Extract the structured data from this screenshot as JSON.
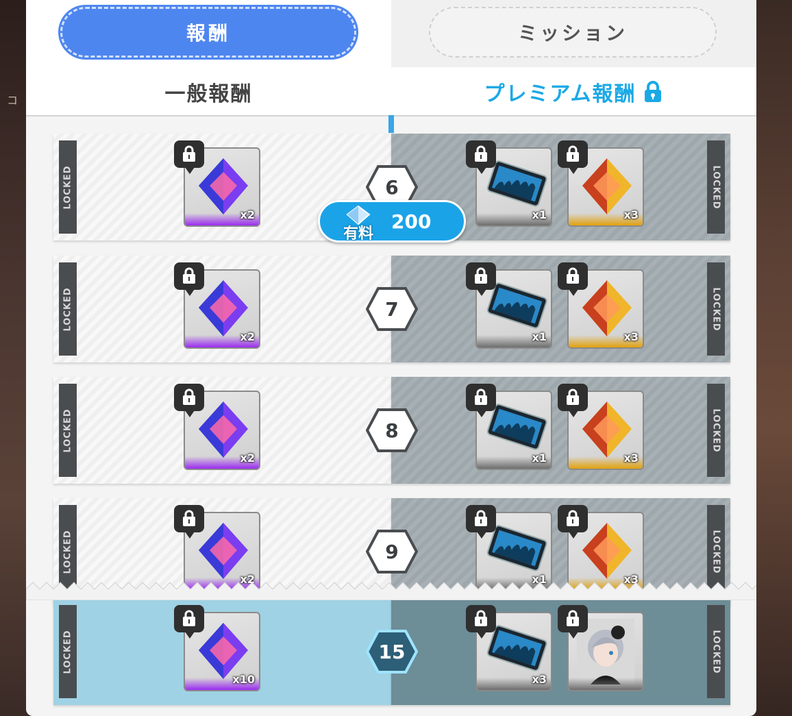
{
  "tabs": {
    "reward": "報酬",
    "mission": "ミッション"
  },
  "columns": {
    "general": "一般報酬",
    "premium": "プレミアム報酬"
  },
  "locked_label": "LOCKED",
  "paid_badge": {
    "label": "有料",
    "amount": "200"
  },
  "rows": [
    {
      "level": "6",
      "general": {
        "qty": "x2"
      },
      "premium": [
        {
          "qty": "x1"
        },
        {
          "qty": "x3"
        }
      ]
    },
    {
      "level": "7",
      "general": {
        "qty": "x2"
      },
      "premium": [
        {
          "qty": "x1"
        },
        {
          "qty": "x3"
        }
      ]
    },
    {
      "level": "8",
      "general": {
        "qty": "x2"
      },
      "premium": [
        {
          "qty": "x1"
        },
        {
          "qty": "x3"
        }
      ]
    },
    {
      "level": "9",
      "general": {
        "qty": "x2"
      },
      "premium": [
        {
          "qty": "x1"
        },
        {
          "qty": "x3"
        }
      ]
    },
    {
      "level": "15",
      "general": {
        "qty": "x10"
      },
      "premium": [
        {
          "qty": "x3"
        },
        {
          "qty": ""
        }
      ]
    }
  ],
  "colors": {
    "tab_active": "#4e86f0",
    "premium_text": "#1ba9e6",
    "paid_badge": "#1ba3e8",
    "rarity_purple": "#9b2cf0",
    "rarity_gold": "#e2a10d"
  },
  "icons": {
    "premium_lock": "lock-icon",
    "item_lock": "lock-icon",
    "general_item": "purple-crystal-icon",
    "premium_item_1": "ticket-card-icon",
    "premium_item_2": "gold-crystal-icon",
    "premium_item_final": "character-portrait-icon"
  }
}
